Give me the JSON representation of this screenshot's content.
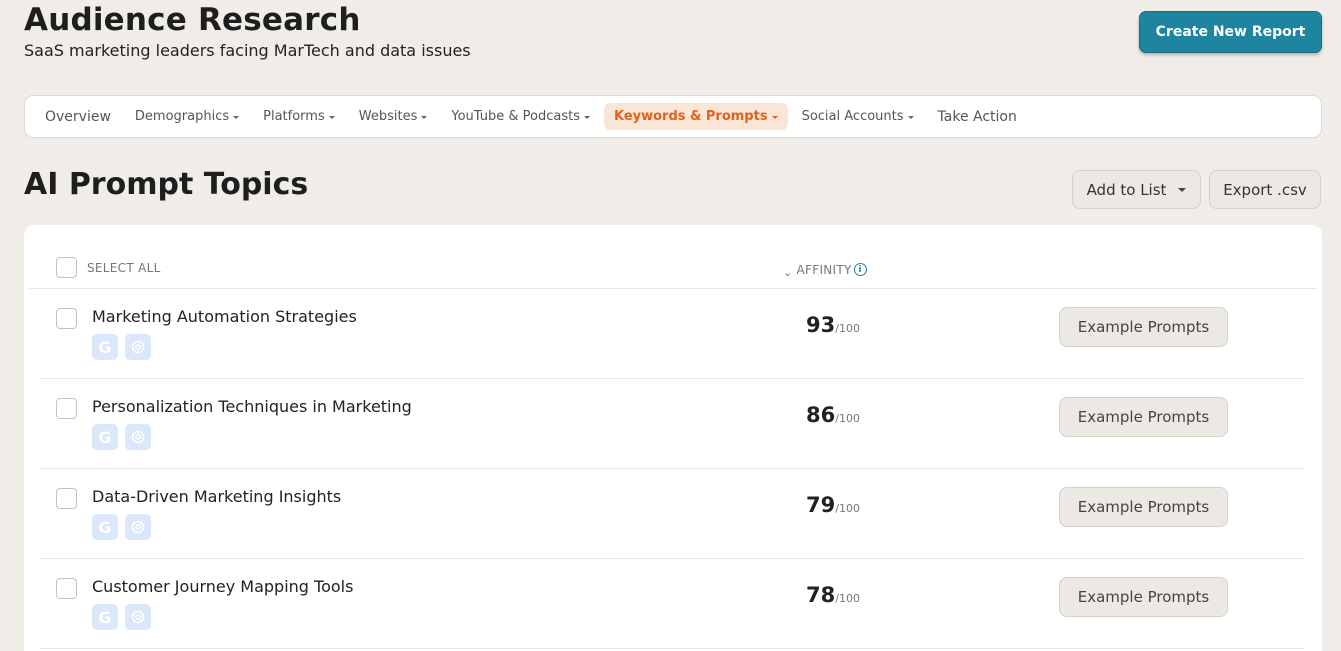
{
  "header": {
    "title": "Audience Research",
    "subtitle": "SaaS marketing leaders facing MarTech and data issues",
    "create_button": "Create New Report"
  },
  "nav": {
    "items": [
      {
        "label": "Overview",
        "dropdown": false,
        "active": false
      },
      {
        "label": "Demographics",
        "dropdown": true,
        "active": false
      },
      {
        "label": "Platforms",
        "dropdown": true,
        "active": false
      },
      {
        "label": "Websites",
        "dropdown": true,
        "active": false
      },
      {
        "label": "YouTube & Podcasts",
        "dropdown": true,
        "active": false
      },
      {
        "label": "Keywords & Prompts",
        "dropdown": true,
        "active": true
      },
      {
        "label": "Social Accounts",
        "dropdown": true,
        "active": false
      },
      {
        "label": "Take Action",
        "dropdown": false,
        "active": false
      }
    ]
  },
  "section": {
    "title": "AI Prompt Topics",
    "add_to_list": "Add to List",
    "export": "Export .csv"
  },
  "table": {
    "select_all_label": "SELECT ALL",
    "affinity_label": "AFFINITY",
    "example_prompts_label": "Example Prompts",
    "score_suffix": "/100",
    "rows": [
      {
        "topic": "Marketing Automation Strategies",
        "affinity": "93"
      },
      {
        "topic": "Personalization Techniques in Marketing",
        "affinity": "86"
      },
      {
        "topic": "Data-Driven Marketing Insights",
        "affinity": "79"
      },
      {
        "topic": "Customer Journey Mapping Tools",
        "affinity": "78"
      }
    ]
  },
  "colors": {
    "background": "#f0ede8",
    "primary": "#1f84a0",
    "active_tab_text": "#e0621c",
    "active_tab_bg": "#fbe5d7",
    "source_icon_bg": "#dbe7fb"
  },
  "icons": {
    "source_google": "google-icon",
    "source_chatgpt": "chatgpt-icon",
    "info": "info-icon"
  }
}
